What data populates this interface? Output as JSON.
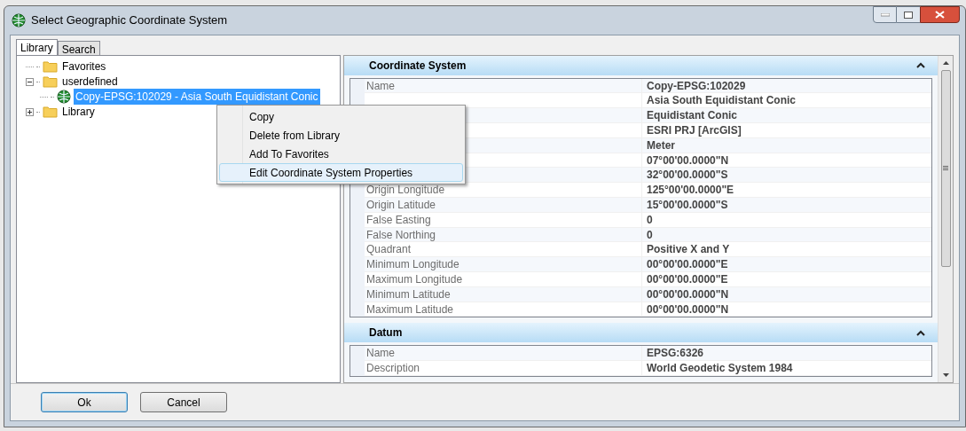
{
  "window": {
    "title": "Select Geographic Coordinate System"
  },
  "tabs": [
    {
      "label": "Library",
      "selected": true
    },
    {
      "label": "Search",
      "selected": false
    }
  ],
  "tree": [
    {
      "label": "Favorites",
      "kind": "folder",
      "selected": false
    },
    {
      "label": "userdefined",
      "kind": "folder",
      "expanded": true,
      "selected": false,
      "children": [
        {
          "label": "Copy-EPSG:102029 - Asia South Equidistant Conic",
          "kind": "system",
          "selected": true
        }
      ]
    },
    {
      "label": "Library",
      "kind": "folder",
      "expanded": false,
      "selected": false
    }
  ],
  "context_menu": [
    {
      "label": "Copy",
      "selected": false
    },
    {
      "label": "Delete from Library",
      "selected": false
    },
    {
      "label": "Add To Favorites",
      "selected": false
    },
    {
      "label": "Edit Coordinate System Properties",
      "selected": true
    }
  ],
  "sections": [
    {
      "title": "Coordinate System",
      "expanded": true,
      "rows": [
        {
          "label": "Name",
          "value": "Copy-EPSG:102029"
        },
        {
          "value": "Asia South Equidistant Conic"
        },
        {
          "value": "Equidistant Conic"
        },
        {
          "value": "ESRI PRJ [ArcGIS]"
        },
        {
          "value": "Meter"
        },
        {
          "value": "07°00'00.0000\"N"
        },
        {
          "value": "32°00'00.0000\"S"
        },
        {
          "label": "Origin Longitude",
          "value": "125°00'00.0000\"E"
        },
        {
          "label": "Origin Latitude",
          "value": "15°00'00.0000\"S"
        },
        {
          "label": "False Easting",
          "value": "0"
        },
        {
          "label": "False Northing",
          "value": "0"
        },
        {
          "label": "Quadrant",
          "value": "Positive X and Y"
        },
        {
          "label": "Minimum Longitude",
          "value": "00°00'00.0000\"E"
        },
        {
          "label": "Maximum Longitude",
          "value": "00°00'00.0000\"E"
        },
        {
          "label": "Minimum Latitude",
          "value": "00°00'00.0000\"N"
        },
        {
          "label": "Maximum Latitude",
          "value": "00°00'00.0000\"N"
        }
      ]
    },
    {
      "title": "Datum",
      "expanded": true,
      "rows": [
        {
          "label": "Name",
          "value": "EPSG:6326"
        },
        {
          "label": "Description",
          "value": "World Geodetic System 1984"
        }
      ]
    }
  ],
  "buttons": [
    {
      "label": "Ok",
      "kind": "default"
    },
    {
      "label": "Cancel",
      "kind": "normal"
    }
  ]
}
